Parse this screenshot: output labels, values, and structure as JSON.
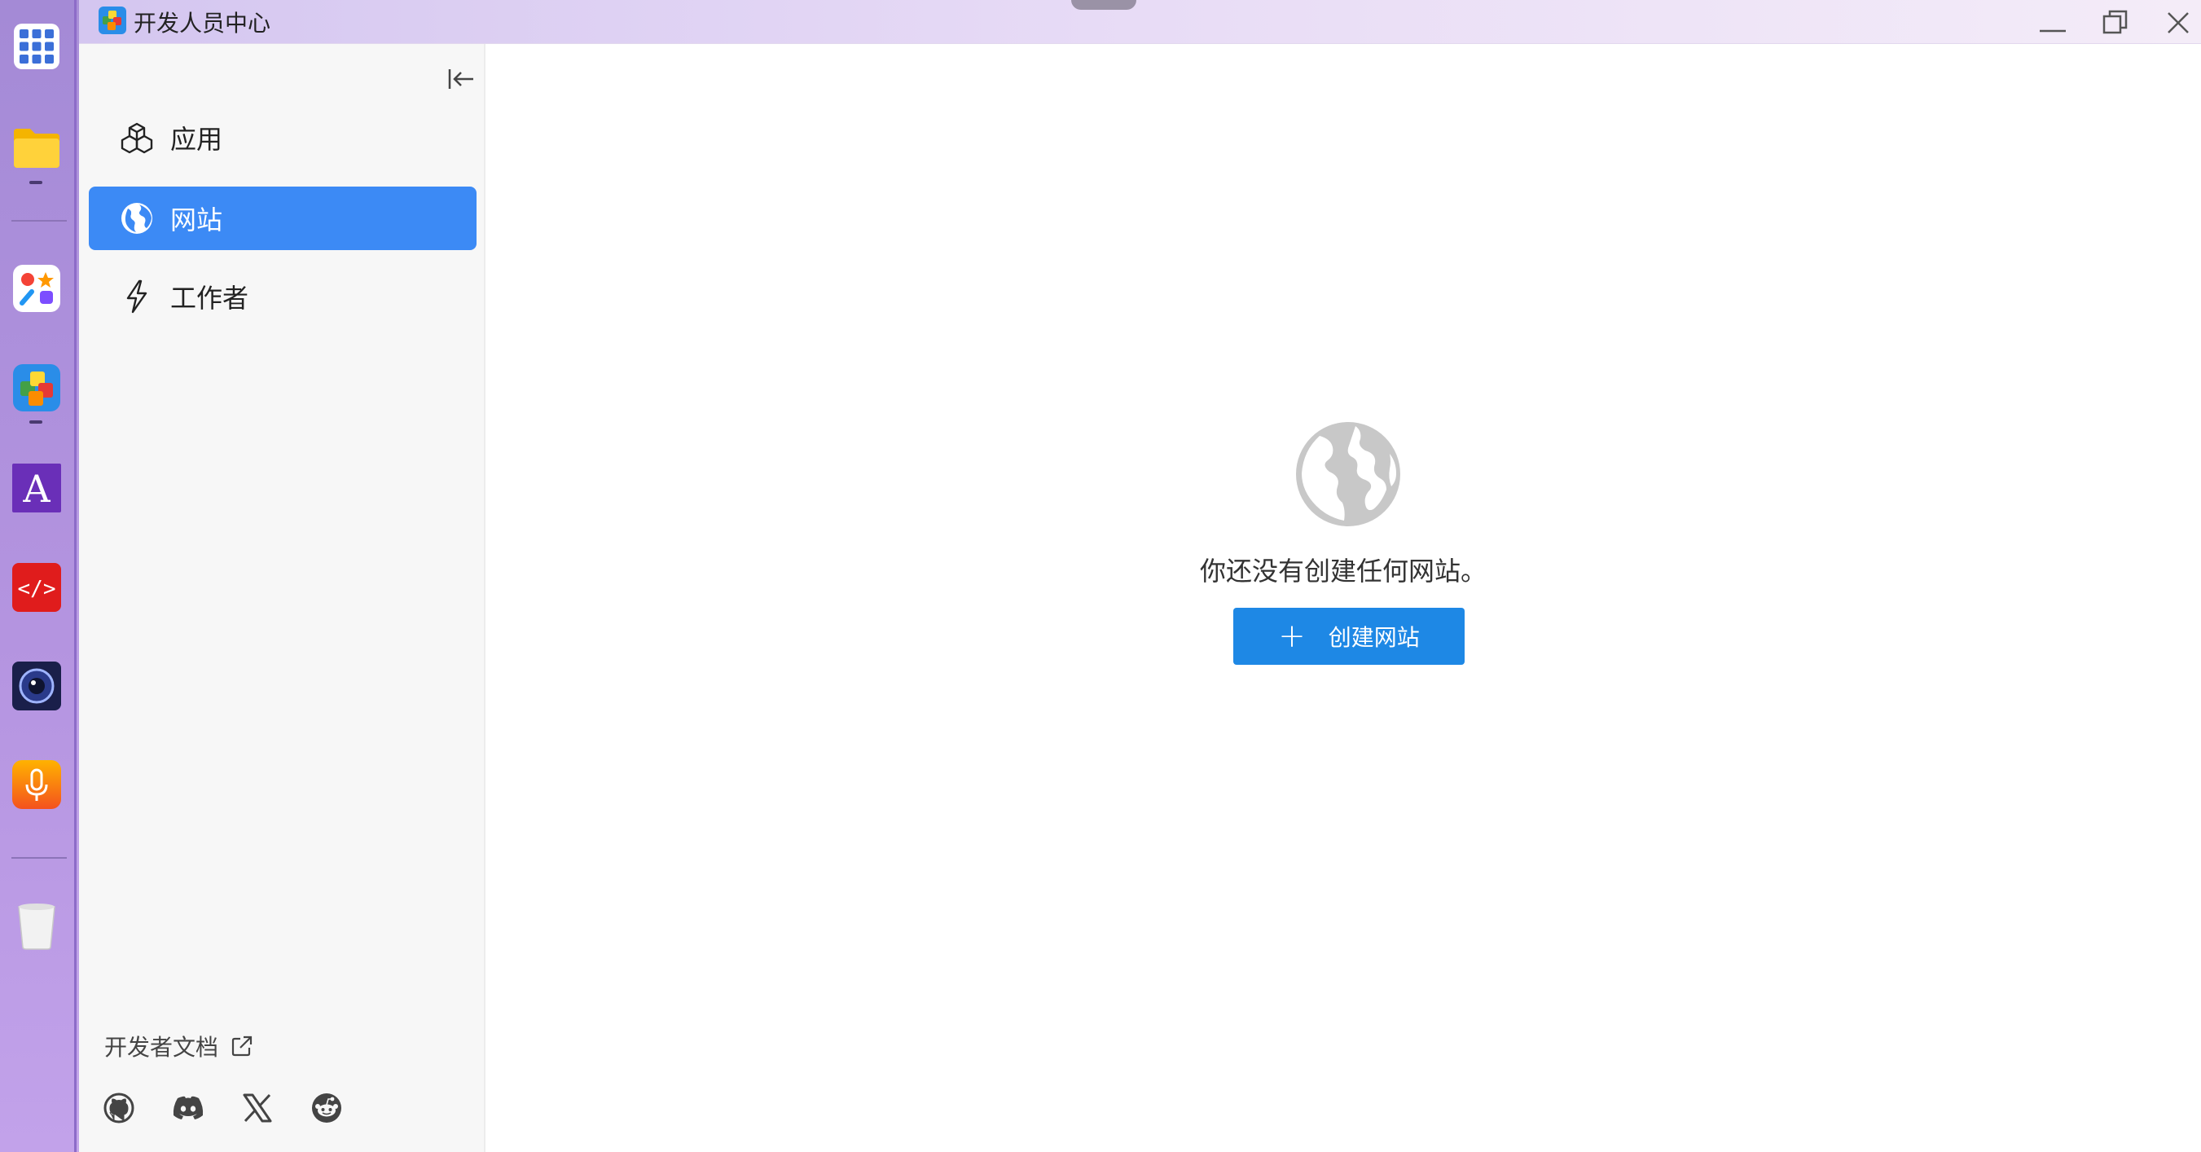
{
  "window": {
    "title": "开发人员中心"
  },
  "dock": {
    "items": [
      {
        "name": "app-grid-icon"
      },
      {
        "name": "files-icon"
      },
      {
        "name": "app-center-icon"
      },
      {
        "name": "developer-center-icon"
      },
      {
        "name": "font-viewer-icon"
      },
      {
        "name": "code-editor-icon"
      },
      {
        "name": "camera-icon"
      },
      {
        "name": "voice-recorder-icon"
      },
      {
        "name": "trash-icon"
      }
    ]
  },
  "sidebar": {
    "items": [
      {
        "label": "应用",
        "icon": "cube-icon"
      },
      {
        "label": "网站",
        "icon": "globe-icon",
        "active": true
      },
      {
        "label": "工作者",
        "icon": "lightning-icon"
      }
    ],
    "docs_label": "开发者文档",
    "social": [
      "github-icon",
      "discord-icon",
      "x-icon",
      "reddit-icon"
    ]
  },
  "main": {
    "empty_message": "你还没有创建任何网站。",
    "create_button": "创建网站"
  },
  "colors": {
    "accent": "#3c8af5",
    "button": "#1e88e5"
  }
}
